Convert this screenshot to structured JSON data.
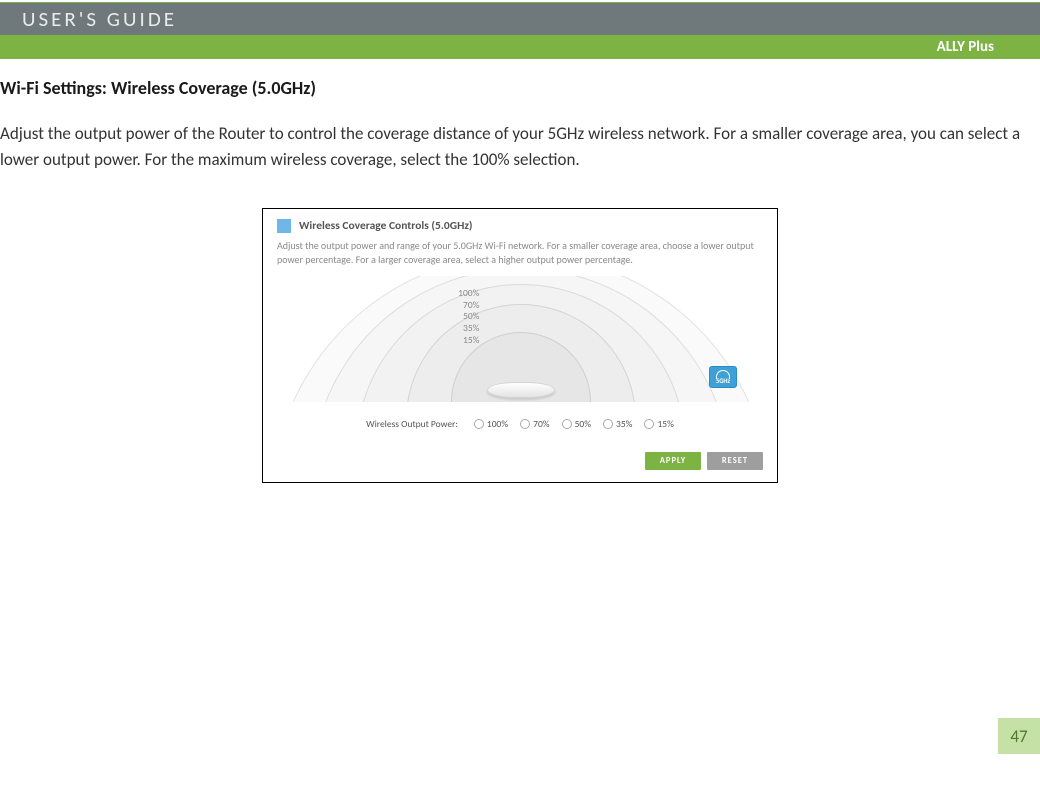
{
  "header": {
    "guide_label": "USER'S GUIDE",
    "product_name": "ALLY Plus"
  },
  "section": {
    "title": "Wi-Fi Settings: Wireless Coverage (5.0GHz)",
    "intro": "Adjust the output power of the Router to control the coverage distance of your 5GHz wireless network.  For a smaller coverage area, you can select a lower output power. For the maximum wireless coverage, select the 100% selection."
  },
  "panel": {
    "title": "Wireless Coverage Controls (5.0GHz)",
    "description": "Adjust the output power and range of your 5.0GHz Wi-Fi network. For a smaller coverage area, choose a lower output power percentage. For a larger coverage area, select a higher output power percentage.",
    "coverage_levels": {
      "l100": "100%",
      "l70": "70%",
      "l50": "50%",
      "l35": "35%",
      "l15": "15%"
    },
    "badge": "5GHz",
    "radio_label": "Wireless Output Power:",
    "options": {
      "o100": "100%",
      "o70": "70%",
      "o50": "50%",
      "o35": "35%",
      "o15": "15%"
    },
    "buttons": {
      "apply": "APPLY",
      "reset": "RESET"
    }
  },
  "page_number": "47"
}
